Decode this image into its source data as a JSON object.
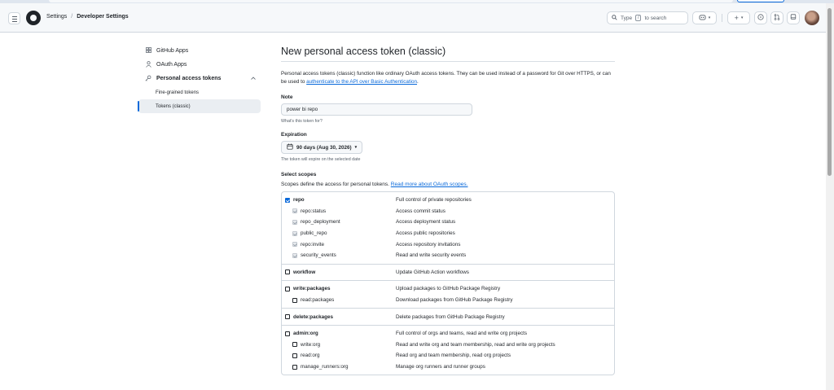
{
  "header": {
    "breadcrumb_settings": "Settings",
    "breadcrumb_sep": "/",
    "breadcrumb_current": "Developer Settings",
    "search_prefix": "Type",
    "search_key": "/",
    "search_suffix": "to search",
    "plus_label": "+",
    "caret": "▾"
  },
  "sidebar": {
    "github_apps": "GitHub Apps",
    "oauth_apps": "OAuth Apps",
    "pat": "Personal access tokens",
    "fine_grained": "Fine-grained tokens",
    "classic": "Tokens (classic)"
  },
  "main": {
    "title": "New personal access token (classic)",
    "description": "Personal access tokens (classic) function like ordinary OAuth access tokens. They can be used instead of a password for Git over HTTPS, or can be used to",
    "description_link": "authenticate to the API over Basic Authentication",
    "description_end": ".",
    "note_label": "Note",
    "note_value": "power bi repo",
    "note_hint": "What's this token for?",
    "expiration_label": "Expiration",
    "expiration_value": "90 days (Aug 30, 2026)",
    "expiration_hint": "The token will expire on the selected date",
    "scopes_label": "Select scopes",
    "scopes_desc": "Scopes define the access for personal tokens.",
    "scopes_link": "Read more about OAuth scopes."
  },
  "scopes": [
    {
      "name": "repo",
      "desc": "Full control of private repositories",
      "checked": true,
      "children": [
        {
          "name": "repo:status",
          "desc": "Access commit status"
        },
        {
          "name": "repo_deployment",
          "desc": "Access deployment status"
        },
        {
          "name": "public_repo",
          "desc": "Access public repositories"
        },
        {
          "name": "repo:invite",
          "desc": "Access repository invitations"
        },
        {
          "name": "security_events",
          "desc": "Read and write security events"
        }
      ]
    },
    {
      "name": "workflow",
      "desc": "Update GitHub Action workflows",
      "checked": false,
      "children": []
    },
    {
      "name": "write:packages",
      "desc": "Upload packages to GitHub Package Registry",
      "checked": false,
      "children": [
        {
          "name": "read:packages",
          "desc": "Download packages from GitHub Package Registry"
        }
      ]
    },
    {
      "name": "delete:packages",
      "desc": "Delete packages from GitHub Package Registry",
      "checked": false,
      "children": []
    },
    {
      "name": "admin:org",
      "desc": "Full control of orgs and teams, read and write org projects",
      "checked": false,
      "children": [
        {
          "name": "write:org",
          "desc": "Read and write org and team membership, read and write org projects"
        },
        {
          "name": "read:org",
          "desc": "Read org and team membership, read org projects"
        },
        {
          "name": "manage_runners:org",
          "desc": "Manage org runners and runner groups"
        }
      ]
    }
  ]
}
